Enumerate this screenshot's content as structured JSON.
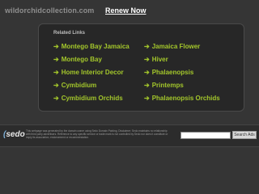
{
  "header": {
    "domain": "wildorchidcollection.com",
    "renew_label": "Renew Now"
  },
  "related_links": {
    "title": "Related Links",
    "arrow": "➔",
    "left": [
      "Montego Bay Jamaica",
      "Montego Bay",
      "Home Interior Decor",
      "Cymbidium",
      "Cymbidium Orchids"
    ],
    "right": [
      "Jamaica Flower",
      "Hiver",
      "Phalaenopsis",
      "Printemps",
      "Phalaenopsis Orchids"
    ]
  },
  "footer": {
    "logo": "sedo",
    "disclaimer_lead": "This webpage was generated by the domain owner using Sedo Domain Parking. Disclaimer: Sedo maintains no relationship with third party advertisers. Reference to any specific service or trade mark is not controlled by Sedo nor does it constitute or imply its association, endorsement or recommendation.",
    "search_button": "Search Ads"
  },
  "colors": {
    "background": "#353535",
    "panel": "#272727",
    "link": "#a3c62b"
  }
}
